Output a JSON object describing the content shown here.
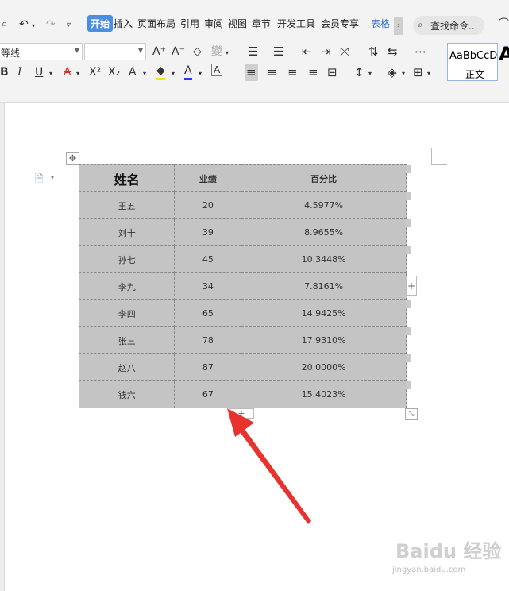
{
  "menu": {
    "tabs": [
      "开始",
      "插入",
      "页面布局",
      "引用",
      "审阅",
      "视图",
      "章节",
      "开发工具",
      "会员专享",
      "表格"
    ],
    "active_tab": "开始",
    "more": "›",
    "search_placeholder": "查找命令..."
  },
  "toolbar": {
    "font_name": "等线",
    "font_size": "",
    "grow_font": "A⁺",
    "shrink_font": "A⁻",
    "clear_format": "◇",
    "phonetic": "變",
    "bold": "B",
    "italic": "I",
    "underline": "U",
    "strikethrough": "A",
    "superscript": "X²",
    "subscript": "X₂",
    "text_effect": "A",
    "highlight": "◆",
    "font_color": "A",
    "border_char": "A",
    "style_sample": "AaBbCcD",
    "style_name": "正文",
    "big_style": "A"
  },
  "toolbar_colors": {
    "highlight": "#f5e11a",
    "font_color": "#1e3cff",
    "strike_color": "#d93025"
  },
  "table": {
    "headers": [
      "姓名",
      "业绩",
      "百分比"
    ],
    "rows": [
      [
        "王五",
        "20",
        "4.5977%"
      ],
      [
        "刘十",
        "39",
        "8.9655%"
      ],
      [
        "孙七",
        "45",
        "10.3448%"
      ],
      [
        "李九",
        "34",
        "7.8161%"
      ],
      [
        "李四",
        "65",
        "14.9425%"
      ],
      [
        "张三",
        "78",
        "17.9310%"
      ],
      [
        "赵八",
        "87",
        "20.0000%"
      ],
      [
        "钱六",
        "67",
        "15.4023%"
      ]
    ],
    "add_row": "+",
    "add_col": "+",
    "move_handle": "✥",
    "resize_handle": "⤡"
  },
  "watermark": {
    "text": "Baidu 经验",
    "url": "jingyan.baidu.com"
  }
}
